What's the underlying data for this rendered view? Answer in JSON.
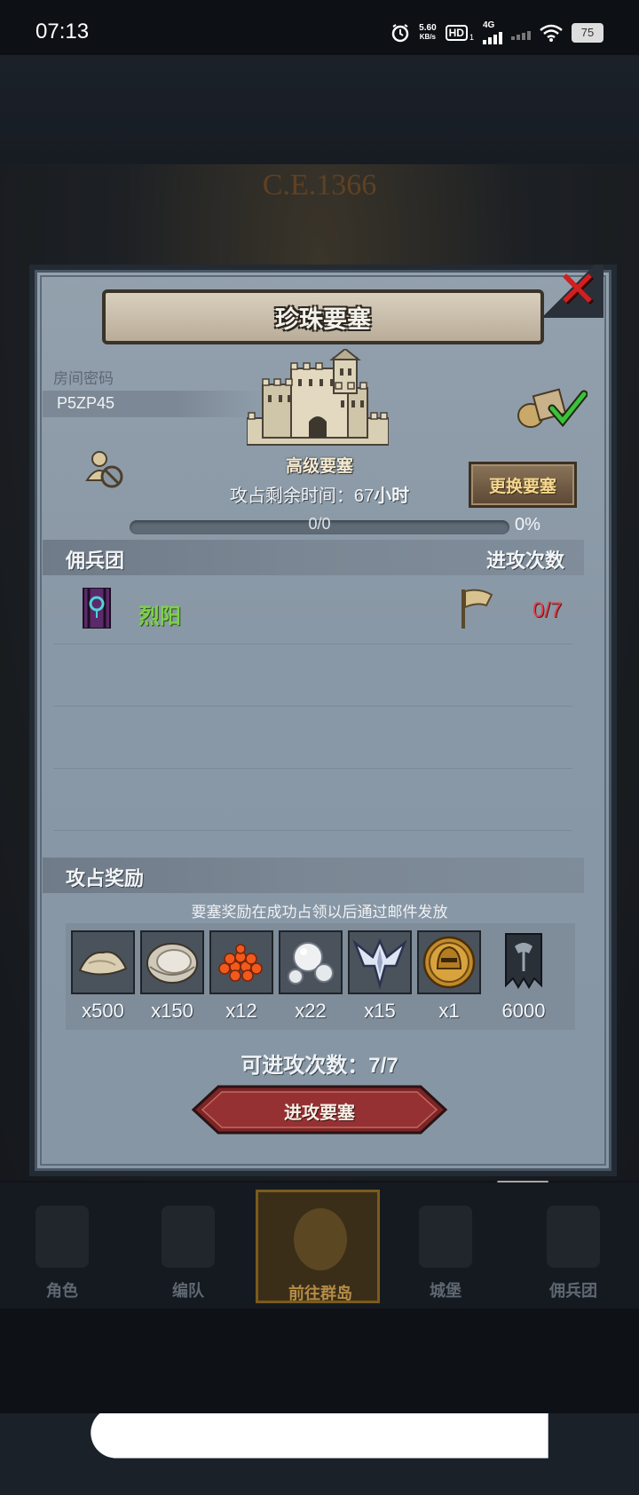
{
  "status_bar": {
    "time": "07:13",
    "net_speed_value": "5.60",
    "net_speed_unit": "KB/s",
    "hd": "HD",
    "hd_sub": "1",
    "network": "4G",
    "battery": "75"
  },
  "background": {
    "year": "C.E.1366"
  },
  "modal": {
    "title": "珍珠要塞",
    "room_label": "房间密码",
    "room_code": "P5ZP45",
    "fortress_level": "高级要塞",
    "change_button": "更换要塞",
    "remaining_time_label": "攻占剩余时间：67",
    "remaining_time_unit": "小时",
    "progress_text": "0/0",
    "progress_percent": "0%",
    "progress_value": 0,
    "mercenary_header": "佣兵团",
    "attacks_header": "进攻次数",
    "guild_rows": [
      {
        "name": "烈阳",
        "attacks": "0/7"
      }
    ],
    "rewards_header": "攻占奖励",
    "rewards_note": "要塞奖励在成功占领以后通过邮件发放",
    "rewards": [
      {
        "icon": "sand-pile-icon",
        "qty": "x500"
      },
      {
        "icon": "oyster-shell-icon",
        "qty": "x150"
      },
      {
        "icon": "fish-roe-icon",
        "qty": "x12"
      },
      {
        "icon": "pearls-icon",
        "qty": "x22"
      },
      {
        "icon": "winged-emblem-icon",
        "qty": "x15"
      },
      {
        "icon": "golden-helmet-coin-icon",
        "qty": "x1"
      },
      {
        "icon": "axe-banner-icon",
        "qty": "6000"
      }
    ],
    "available_attacks": "可进攻次数：7/7",
    "attack_button": "进攻要塞"
  },
  "game_nav": [
    {
      "label": "角色"
    },
    {
      "label": "编队"
    },
    {
      "label": "前往群岛",
      "active": true
    },
    {
      "label": "城堡"
    },
    {
      "label": "佣兵团"
    }
  ],
  "colors": {
    "panel": "#8998a6",
    "guild_name": "#7dd14a",
    "attack_count": "#e0404a",
    "close": "#d21f1f",
    "change_button_text": "#f6d78f"
  }
}
